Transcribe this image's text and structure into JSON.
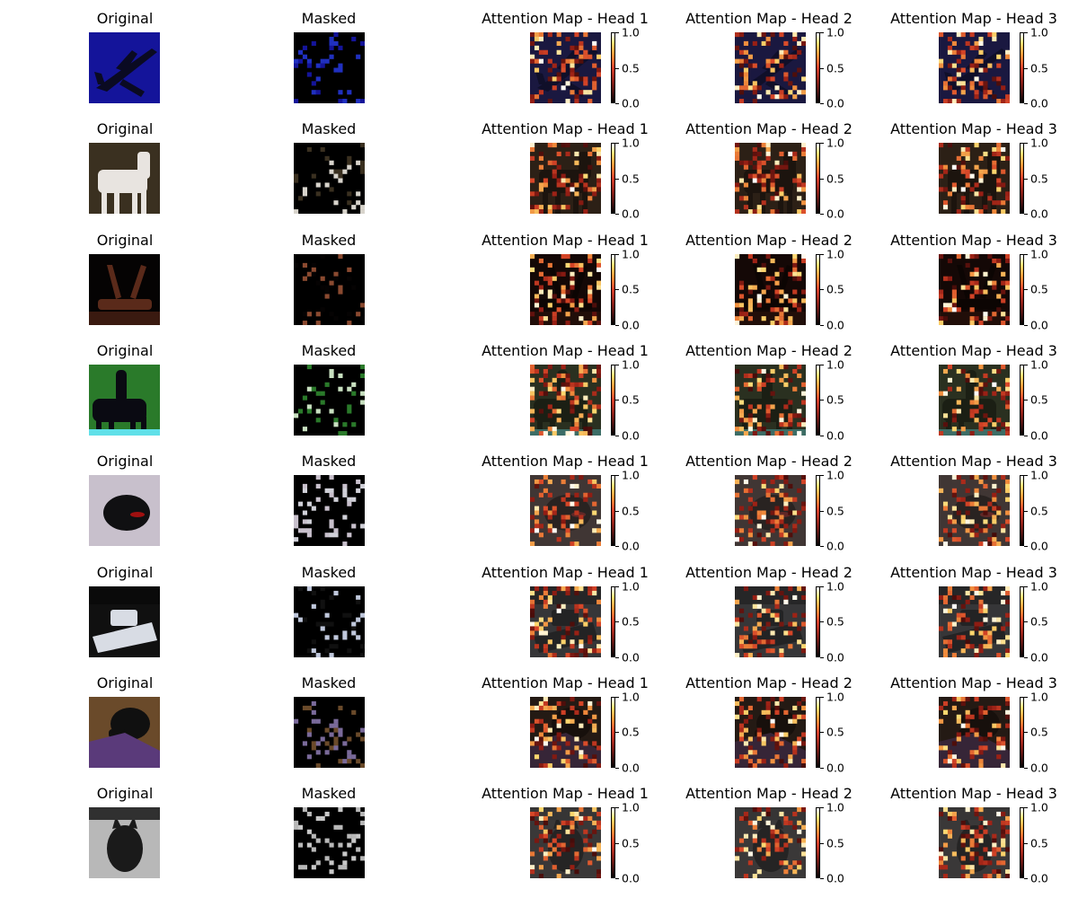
{
  "chart_data": {
    "type": "heatmap",
    "column_titles": [
      "Original",
      "Masked",
      "Attention Map - Head 1",
      "Attention Map - Head 2",
      "Attention Map - Head 3"
    ],
    "colorbar": {
      "colormap": "hot",
      "range": [
        0.0,
        1.0
      ],
      "ticks": [
        "0.0",
        "0.5",
        "1.0"
      ]
    },
    "rows": [
      {
        "subject": "airplane",
        "colors": {
          "bg": "#14149a",
          "obj": "#0a0a22",
          "mask": "#2030c0",
          "att": "#1a1840"
        }
      },
      {
        "subject": "horse (brown/white)",
        "colors": {
          "bg": "#3a3020",
          "obj": "#e8e4e0",
          "mask": "#d8d4cc",
          "att": "#2c2016"
        }
      },
      {
        "subject": "deer",
        "colors": {
          "bg": "#050303",
          "obj": "#5a2a1a",
          "mask": "#8a4a30",
          "att": "#140806"
        }
      },
      {
        "subject": "horse and rider",
        "colors": {
          "bg": "#2a7a2a",
          "obj": "#0a0a12",
          "mask": "#c8e0c0",
          "att": "#2a3020"
        }
      },
      {
        "subject": "car (top view)",
        "colors": {
          "bg": "#c8c0cc",
          "obj": "#101012",
          "mask": "#d0d0d8",
          "att": "#403634"
        }
      },
      {
        "subject": "boat",
        "colors": {
          "bg": "#101010",
          "obj": "#d8dce4",
          "mask": "#c0c8dc",
          "att": "#363638"
        }
      },
      {
        "subject": "cat on blanket",
        "colors": {
          "bg": "#6a4a2a",
          "obj": "#101010",
          "mask": "#7a6a9a",
          "att": "#241a14"
        }
      },
      {
        "subject": "cat (grey)",
        "colors": {
          "bg": "#b8b8b8",
          "obj": "#1a1a1a",
          "mask": "#c8c8c8",
          "att": "#3a3838"
        }
      }
    ]
  }
}
